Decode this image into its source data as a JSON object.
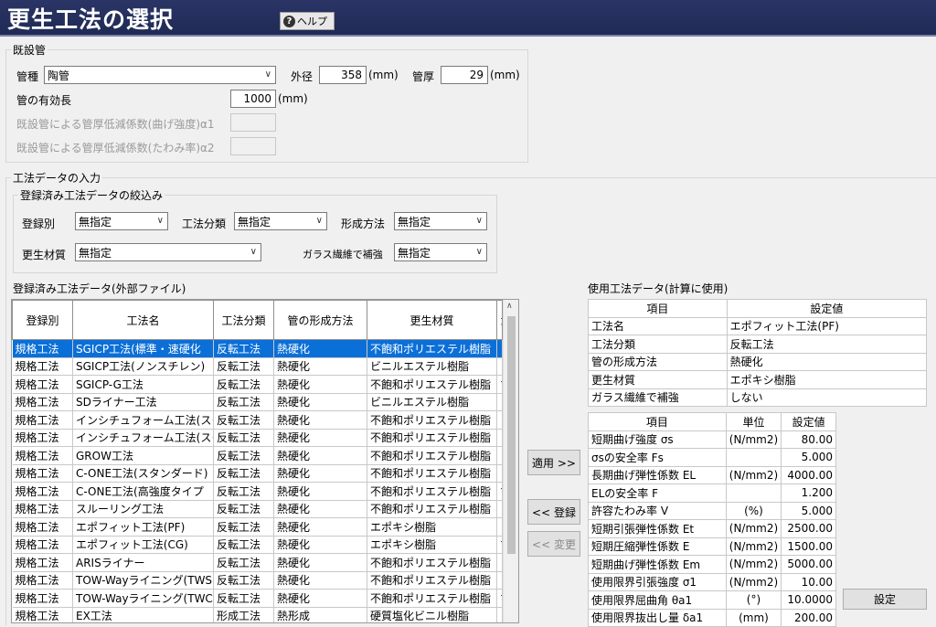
{
  "window": {
    "title": "更生工法の選択",
    "help_label": "ヘルプ"
  },
  "existing": {
    "legend": "既設管",
    "pipe_type_label": "管種",
    "pipe_type_value": "陶管",
    "outer_dia_label": "外径",
    "outer_dia_value": "358",
    "outer_dia_unit": "(mm)",
    "thickness_label": "管厚",
    "thickness_value": "29",
    "thickness_unit": "(mm)",
    "length_label": "管の有効長",
    "length_value": "1000",
    "length_unit": "(mm)",
    "alpha1_label": "既設管による管厚低減係数(曲げ強度)α1",
    "alpha2_label": "既設管による管厚低減係数(たわみ率)α2"
  },
  "method_input": {
    "legend": "工法データの入力",
    "filter": {
      "legend": "登録済み工法データの絞込み",
      "reg_label": "登録別",
      "reg_value": "無指定",
      "class_label": "工法分類",
      "class_value": "無指定",
      "form_label": "形成方法",
      "form_value": "無指定",
      "material_label": "更生材質",
      "material_value": "無指定",
      "glass_label": "ガラス繊維で補強",
      "glass_value": "無指定"
    }
  },
  "registered": {
    "caption": "登録済み工法データ(外部ファイル)",
    "columns": [
      "登録別",
      "工法名",
      "工法分類",
      "管の形成方法",
      "更生材質",
      "ガ"
    ],
    "rows": [
      [
        "規格工法",
        "SGICP工法(標準・速硬化",
        "反転工法",
        "熱硬化",
        "不飽和ポリエステル樹脂",
        "し"
      ],
      [
        "規格工法",
        "SGICP工法(ノンスチレン)",
        "反転工法",
        "熱硬化",
        "ビニルエステル樹脂",
        "し"
      ],
      [
        "規格工法",
        "SGICP-G工法",
        "反転工法",
        "熱硬化",
        "不飽和ポリエステル樹脂",
        "す"
      ],
      [
        "規格工法",
        "SDライナー工法",
        "反転工法",
        "熱硬化",
        "ビニルエステル樹脂",
        "し"
      ],
      [
        "規格工法",
        "インシチュフォーム工法(スタン",
        "反転工法",
        "熱硬化",
        "不飽和ポリエステル樹脂",
        "し"
      ],
      [
        "規格工法",
        "インシチュフォーム工法(スタン",
        "反転工法",
        "熱硬化",
        "不飽和ポリエステル樹脂",
        "し"
      ],
      [
        "規格工法",
        "GROW工法",
        "反転工法",
        "熱硬化",
        "不飽和ポリエステル樹脂",
        "し"
      ],
      [
        "規格工法",
        "C-ONE工法(スタンダード)",
        "反転工法",
        "熱硬化",
        "不飽和ポリエステル樹脂",
        "し"
      ],
      [
        "規格工法",
        "C-ONE工法(高強度タイプ",
        "反転工法",
        "熱硬化",
        "不飽和ポリエステル樹脂",
        "す"
      ],
      [
        "規格工法",
        "スルーリング工法",
        "反転工法",
        "熱硬化",
        "不飽和ポリエステル樹脂",
        "し"
      ],
      [
        "規格工法",
        "エポフィット工法(PF)",
        "反転工法",
        "熱硬化",
        "エポキシ樹脂",
        "し"
      ],
      [
        "規格工法",
        "エポフィット工法(CG)",
        "反転工法",
        "熱硬化",
        "エポキシ樹脂",
        "す"
      ],
      [
        "規格工法",
        "ARISライナー",
        "反転工法",
        "熱硬化",
        "不飽和ポリエステル樹脂",
        "し"
      ],
      [
        "規格工法",
        "TOW-Wayライニング(TWS",
        "反転工法",
        "熱硬化",
        "不飽和ポリエステル樹脂",
        "し"
      ],
      [
        "規格工法",
        "TOW-Wayライニング(TWC",
        "反転工法",
        "熱硬化",
        "不飽和ポリエステル樹脂",
        "す"
      ],
      [
        "規格工法",
        "EX工法",
        "形成工法",
        "熱形成",
        "硬質塩化ビニル樹脂",
        "し"
      ]
    ]
  },
  "buttons": {
    "apply": "適用 >>",
    "register": "<< 登録",
    "change": "<< 変更",
    "set": "設定"
  },
  "used": {
    "caption": "使用工法データ(計算に使用)",
    "col_item": "項目",
    "col_value": "設定値",
    "rows": [
      [
        "工法名",
        "エポフィット工法(PF)"
      ],
      [
        "工法分類",
        "反転工法"
      ],
      [
        "管の形成方法",
        "熱硬化"
      ],
      [
        "更生材質",
        "エポキシ樹脂"
      ],
      [
        "ガラス繊維で補強",
        "しない"
      ]
    ]
  },
  "params": {
    "col_item": "項目",
    "col_unit": "単位",
    "col_value": "設定値",
    "rows": [
      [
        "短期曲げ強度 σs",
        "(N/mm2)",
        "80.00"
      ],
      [
        "σsの安全率 Fs",
        "",
        "5.000"
      ],
      [
        "長期曲げ弾性係数 EL",
        "(N/mm2)",
        "4000.00"
      ],
      [
        "ELの安全率 F",
        "",
        "1.200"
      ],
      [
        "許容たわみ率 V",
        "(%)",
        "5.000"
      ],
      [
        "短期引張弾性係数 Et",
        "(N/mm2)",
        "2500.00"
      ],
      [
        "短期圧縮弾性係数 E",
        "(N/mm2)",
        "1500.00"
      ],
      [
        "短期曲げ弾性係数 Em",
        "(N/mm2)",
        "5000.00"
      ],
      [
        "使用限界引張強度 σ1",
        "(N/mm2)",
        "10.00"
      ],
      [
        "使用限界屈曲角 θa1",
        "(°)",
        "10.0000"
      ],
      [
        "使用限界抜出し量 δa1",
        "(mm)",
        "200.00"
      ]
    ]
  }
}
